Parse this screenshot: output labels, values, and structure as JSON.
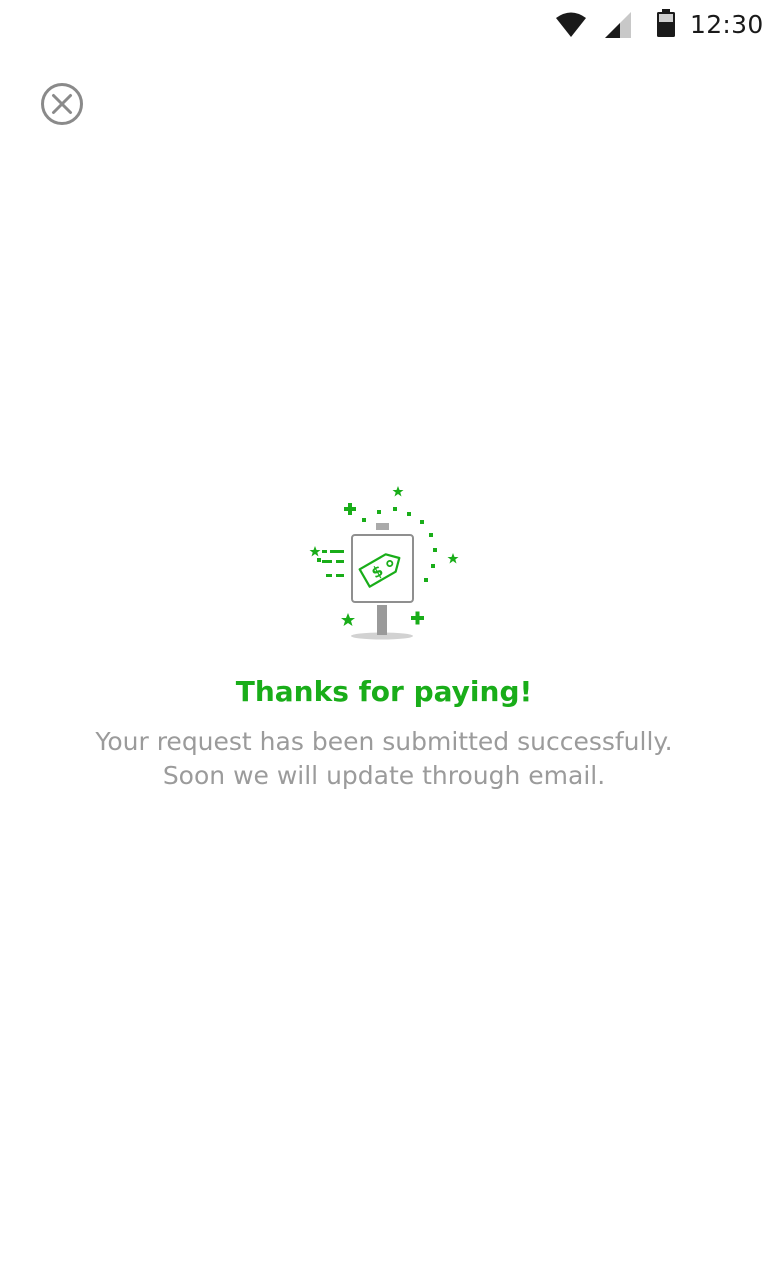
{
  "status_bar": {
    "time": "12:30",
    "icons": [
      "wifi-icon",
      "cellular-signal-icon",
      "battery-icon"
    ]
  },
  "close_icon": "close-circle-icon",
  "illustration_icon": "price-tag-sign-icon",
  "confirmation": {
    "title": "Thanks for paying!",
    "message_line1": "Your request has been submitted successfully.",
    "message_line2": "Soon we will update through email."
  },
  "colors": {
    "accent": "#19ad19",
    "message_text": "#9b9b9b",
    "icon_gray": "#8a8a8a",
    "background": "#ffffff"
  }
}
